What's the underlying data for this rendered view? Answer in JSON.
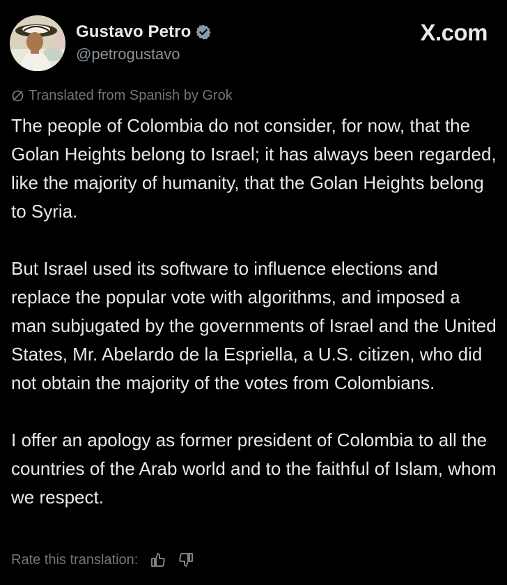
{
  "author": {
    "display_name": "Gustavo Petro",
    "handle": "@petrogustavo",
    "verified_icon": "verified-badge-icon",
    "avatar_icon": "profile-avatar"
  },
  "brand": "X.com",
  "translation": {
    "notice": "Translated from Spanish by Grok",
    "icon": "translate-slash-icon"
  },
  "tweet": {
    "paragraphs": [
      "The people of Colombia do not consider, for now, that the Golan Heights belong to Israel; it has always been regarded, like the majority of humanity, that the Golan Heights belong to Syria.",
      "But Israel used its software to influence elections and replace the popular vote with algorithms, and imposed a man subjugated by the governments of Israel and the United States, Mr. Abelardo de la Espriella, a U.S. citizen, who did not obtain the majority of the votes from Colombians.",
      "I offer an apology as former president of Colombia to all the countries of the Arab world and to the faithful of Islam, whom we respect."
    ]
  },
  "rating": {
    "label": "Rate this translation:",
    "thumbs_up_icon": "thumbs-up-icon",
    "thumbs_down_icon": "thumbs-down-icon"
  },
  "colors": {
    "background": "#000000",
    "primary_text": "#e7e9ea",
    "secondary_text": "#71767b",
    "verified_badge": "#829aab"
  }
}
